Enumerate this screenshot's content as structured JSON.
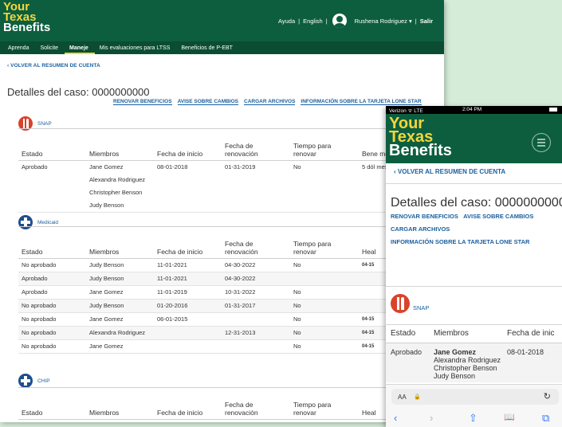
{
  "brand": {
    "line1": "Your",
    "line2": "Texas",
    "line3": "Benefits"
  },
  "colors": {
    "header": "#0d5e3f",
    "accent": "#f5d63a",
    "link": "#1a5f9e",
    "snap": "#d9432b",
    "medicaid": "#1f4e8c"
  },
  "desktop": {
    "util": {
      "help": "Ayuda",
      "lang": "English",
      "user": "Rushena Rodriguez ▾",
      "logout": "Salir",
      "sep": "|"
    },
    "nav": [
      "Aprenda",
      "Solicite",
      "Maneje",
      "Mis evaluaciones para LTSS",
      "Beneficios de P-EBT"
    ],
    "back": "VOLVER AL RESUMEN DE CUENTA",
    "title": "Detalles del caso: 0000000000",
    "actions": [
      "RENOVAR BENEFICIOS",
      "AVISE SOBRE CAMBIOS",
      "CARGAR ARCHIVOS",
      "INFORMACIÓN SOBRE LA TARJETA LONE STAR"
    ],
    "snap": {
      "name": "SNAP",
      "headers": [
        "Estado",
        "Miembros",
        "Fecha de inicio",
        "Fecha de renovación",
        "Tiempo para renovar",
        "Bene men"
      ],
      "rows": [
        [
          "Aprobado",
          "Jane Gomez\nAlexandra Rodriguez\nChristopher Benson\nJudy Benson",
          "08-01-2018",
          "01-31-2019",
          "No",
          "5 dól mes"
        ]
      ]
    },
    "medicaid": {
      "name": "Medicaid",
      "headers": [
        "Estado",
        "Miembros",
        "Fecha de inicio",
        "Fecha de renovación",
        "Tiempo para renovar",
        "Heal"
      ],
      "rows": [
        [
          "No aprobado",
          "Judy Benson",
          "11-01-2021",
          "04-30-2022",
          "No",
          "04-15"
        ],
        [
          "Aprobado",
          "Judy Benson",
          "11-01-2021",
          "04-30-2022",
          "",
          ""
        ],
        [
          "Aprobado",
          "Jane Gomez",
          "11-01-2019",
          "10-31-2022",
          "No",
          ""
        ],
        [
          "No aprobado",
          "Judy Benson",
          "01-20-2016",
          "01-31-2017",
          "No",
          ""
        ],
        [
          "No aprobado",
          "Jane Gomez",
          "06-01-2015",
          "",
          "No",
          "04-15"
        ],
        [
          "No aprobado",
          "Alexandra Rodriguez",
          "",
          "12-31-2013",
          "No",
          "04-15"
        ],
        [
          "No aprobado",
          "Jane Gomez",
          "",
          "",
          "No",
          "04-15"
        ]
      ]
    },
    "chip": {
      "name": "CHIP",
      "headers": [
        "Estado",
        "Miembros",
        "Fecha de inicio",
        "Fecha de renovación",
        "Tiempo para renovar",
        "Heal"
      ]
    }
  },
  "mobile": {
    "status": {
      "carrier": "Verizon ᯤ LTE",
      "time": "2:04 PM"
    },
    "back": "VOLVER AL RESUMEN DE CUENTA",
    "title": "Detalles del caso: 0000000000",
    "links": [
      "RENOVAR BENEFICIOS",
      "AVISE SOBRE CAMBIOS",
      "CARGAR ARCHIVOS",
      "INFORMACIÓN SOBRE LA TARJETA LONE STAR"
    ],
    "snap": {
      "name": "SNAP",
      "headers": [
        "Estado",
        "Miembros",
        "Fecha de inic"
      ],
      "row": {
        "estado": "Aprobado",
        "members": [
          "Jane Gomez",
          "Alexandra Rodriguez",
          "Christopher Benson",
          "Judy Benson"
        ],
        "fecha": "08-01-2018"
      }
    },
    "toolbar": {
      "aa": "AA",
      "lock": "🔒",
      "reload": "↻",
      "back": "‹",
      "forward": "›",
      "share": "⇧",
      "bookmarks": "📖",
      "tabs": "⧉"
    }
  }
}
